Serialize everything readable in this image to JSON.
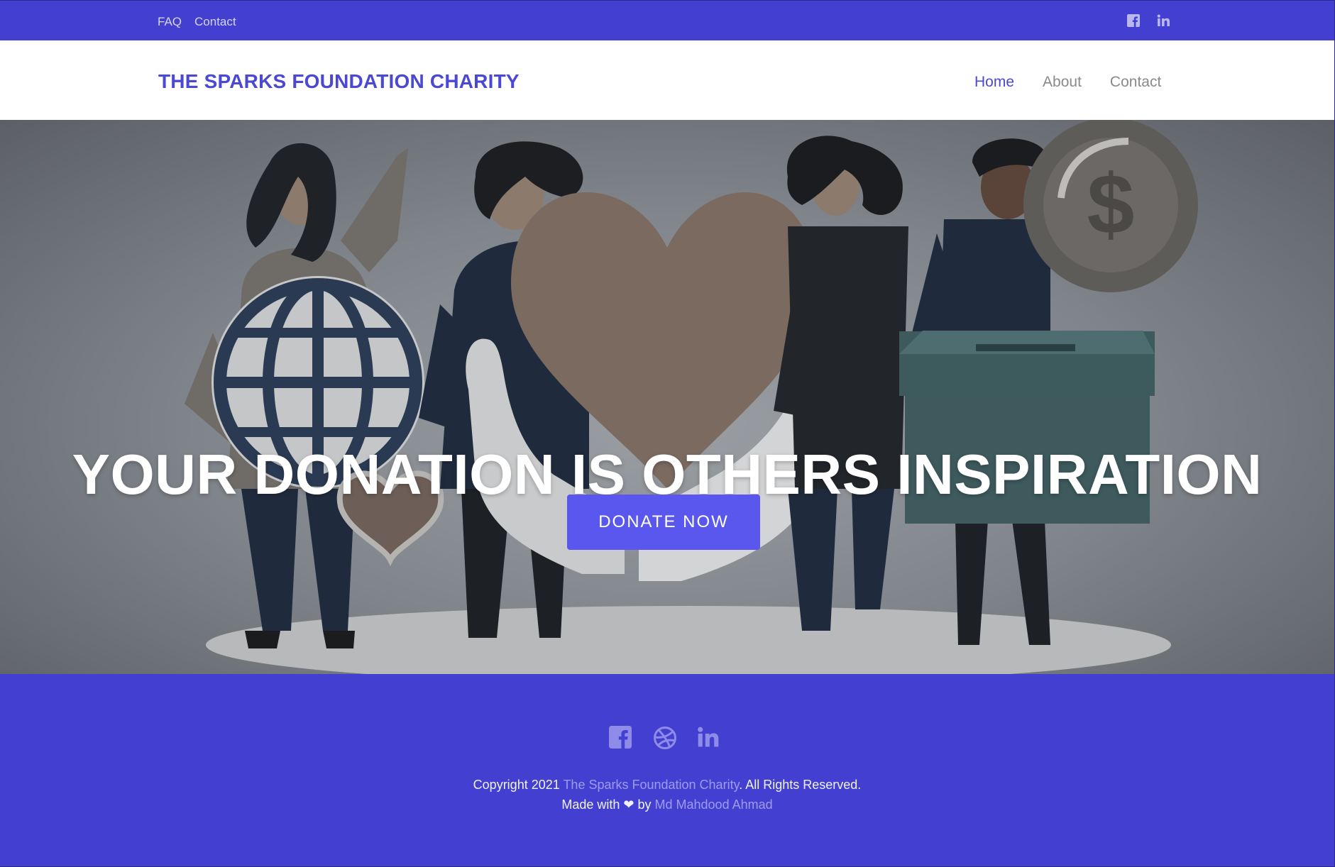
{
  "topbar": {
    "links": [
      "FAQ",
      "Contact"
    ],
    "social_icons": [
      "facebook-icon",
      "linkedin-icon"
    ]
  },
  "navbar": {
    "brand": "THE SPARKS FOUNDATION CHARITY",
    "items": [
      {
        "label": "Home",
        "active": true
      },
      {
        "label": "About",
        "active": false
      },
      {
        "label": "Contact",
        "active": false
      }
    ]
  },
  "hero": {
    "title": "YOUR DONATION IS OTHERS INSPIRATION",
    "button_label": "DONATE NOW"
  },
  "footer": {
    "social_icons": [
      "facebook-icon",
      "dribbble-icon",
      "linkedin-icon"
    ],
    "copyright_prefix": "Copyright 2021 ",
    "copyright_link": "The Sparks Foundation Charity",
    "copyright_suffix": ". All Rights Reserved.",
    "made_with_prefix": "Made with ",
    "made_with_by": " by ",
    "author": "Md Mahdood Ahmad"
  },
  "colors": {
    "primary": "#4340d1",
    "brand": "#4b48d3",
    "button": "#5a57ee",
    "footer_link": "#9e9cf0"
  }
}
